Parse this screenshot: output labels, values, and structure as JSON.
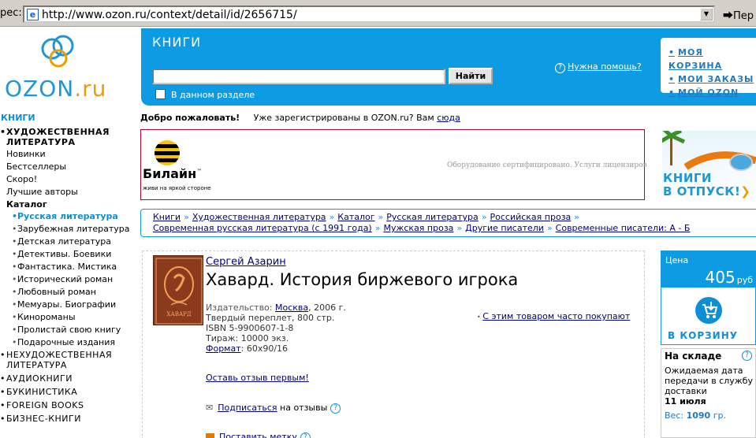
{
  "browser": {
    "address_label": "рес:",
    "url": "http://www.ozon.ru/context/detail/id/2656715/",
    "go_label": "Пер"
  },
  "logo": {
    "text_main": "OZON",
    "text_suffix": ".ru"
  },
  "header": {
    "title": "КНИГИ",
    "search_button": "Найти",
    "search_placeholder": "",
    "in_section_label": "В данном разделе",
    "help_link": "Нужна помощь?",
    "user_links": [
      "МОЯ КОРЗИНА",
      "МОИ ЗАКАЗЫ",
      "МОЙ OZON"
    ]
  },
  "welcome": {
    "greeting": "Добро пожаловать!",
    "registered_text": "Уже зарегистрированы в OZON.ru? Вам",
    "registered_link": "сюда"
  },
  "sidebar": {
    "title": "КНИГИ",
    "top_section": "ХУДОЖЕСТВЕННАЯ ЛИТЕРАТУРА",
    "plain_items": [
      "Новинки",
      "Бестселлеры",
      "Скоро!",
      "Лучшие авторы"
    ],
    "catalog_label": "Каталог",
    "sub_items": [
      "Русская литература",
      "Зарубежная литература",
      "Детская литература",
      "Детективы. Боевики",
      "Фантастика. Мистика",
      "Исторический роман",
      "Любовный роман",
      "Мемуары. Биографии",
      "Кинороманы",
      "Пролистай свою книгу",
      "Подарочные издания"
    ],
    "root_items": [
      "НЕХУДОЖЕСТВЕННАЯ ЛИТЕРАТУРА",
      "АУДИОКНИГИ",
      "БУКИНИСТИКА",
      "FOREIGN BOOKS",
      "БИЗНЕС-КНИГИ"
    ]
  },
  "banner": {
    "brand": "Билайн",
    "trademark": "™",
    "slogan": "живи на яркой стороне",
    "fine_print": "Оборудование сертифицировано. Услуги лицензиров"
  },
  "promo": {
    "line1": "КНИГИ",
    "line2": "В ОТПУСК!",
    "arrow": "❯"
  },
  "breadcrumbs": {
    "row1": [
      "Книги",
      "Художественная литература",
      "Каталог",
      "Русская литература",
      "Российская проза"
    ],
    "row2": [
      "Современная русская литература (с 1991 года)",
      "Мужская проза",
      "Другие писатели",
      "Современные писатели: А - Б"
    ],
    "separator": "»"
  },
  "product": {
    "author": "Сергей Азарин",
    "title": "Хавард. История биржевого игрока",
    "cover_text": "ХАВАРД",
    "publisher_label": "Издательство:",
    "publisher": "Москва",
    "year": ", 2006 г.",
    "binding": "Твердый переплет, 800 стр.",
    "isbn": "ISBN   5-9900607-1-8",
    "print_run": "Тираж: 10000 экз.",
    "format_label": "Формат",
    "format_value": ": 60x90/16",
    "also_bought": "С этим товаром часто покупают",
    "review_link": "Оставь отзыв первым!",
    "subscribe_link": "Подписаться",
    "subscribe_suffix": "на отзывы",
    "tags_link": "Поставить метку"
  },
  "price": {
    "label": "Цена",
    "value": "405",
    "currency": "руб",
    "cart_label": "В КОРЗИНУ"
  },
  "stock": {
    "title": "На складе",
    "text": "Ожидаемая дата передачи в службу доставки",
    "date": "11 июля",
    "weight_label": "Вес:",
    "weight_value": "1090",
    "weight_unit": "гр."
  },
  "colors": {
    "brand_blue": "#0d9be3",
    "brand_orange": "#f29b00",
    "link": "#000080"
  }
}
